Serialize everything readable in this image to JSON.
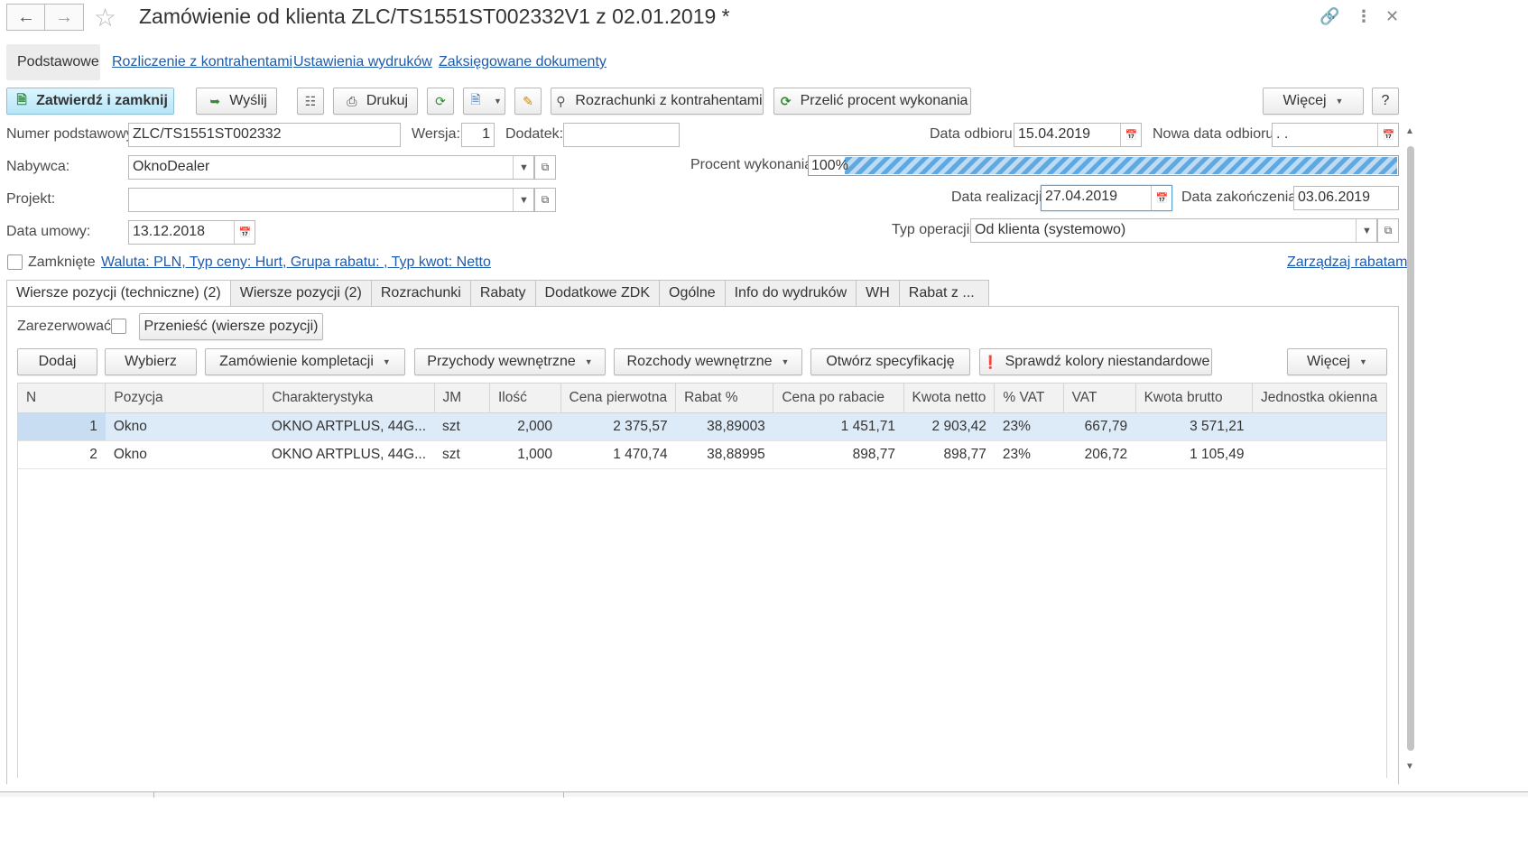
{
  "window": {
    "title": "Zamówienie od klienta ZLC/TS1551ST002332V1 z 02.01.2019 *"
  },
  "nav_tabs": [
    {
      "label": "Podstawowe"
    },
    {
      "label": "Rozliczenie z kontrahentami"
    },
    {
      "label": "Ustawienia wydruków"
    },
    {
      "label": "Zaksięgowane dokumenty"
    }
  ],
  "toolbar": {
    "confirm_close": "Zatwierdź i zamknij",
    "send": "Wyślij",
    "print": "Drukuj",
    "settlements": "Rozrachunki z kontrahentami",
    "recalc": "Przelić procent wykonania",
    "more": "Więcej",
    "help": "?"
  },
  "form": {
    "basic_number_label": "Numer podstawowy:",
    "basic_number": "ZLC/TS1551ST002332",
    "version_label": "Wersja:",
    "version": "1",
    "addendum_label": "Dodatek:",
    "addendum": "",
    "pickup_date_label": "Data odbioru:",
    "pickup_date": "15.04.2019",
    "new_pickup_date_label": "Nowa data odbioru:",
    "new_pickup_date": " .  .",
    "buyer_label": "Nabywca:",
    "buyer": "OknoDealer",
    "progress_label": "Procent wykonania:",
    "progress_text": "100%",
    "progress_value": 100,
    "project_label": "Projekt:",
    "project": "",
    "realization_date_label": "Data realizacji:",
    "realization_date": "27.04.2019",
    "end_date_label": "Data zakończenia:",
    "end_date": "03.06.2019",
    "contract_date_label": "Data umowy:",
    "contract_date": "13.12.2018",
    "operation_type_label": "Typ operacji:",
    "operation_type": "Od klienta (systemowo)",
    "closed_label": "Zamknięte",
    "currency_link": "Waluta: PLN, Typ ceny: Hurt, Grupa rabatu: , Typ kwot: Netto",
    "manage_discounts_link": "Zarządzaj rabatami"
  },
  "inner_tabs": [
    {
      "label": "Wiersze pozycji (techniczne) (2)"
    },
    {
      "label": "Wiersze pozycji (2)"
    },
    {
      "label": "Rozrachunki"
    },
    {
      "label": "Rabaty"
    },
    {
      "label": "Dodatkowe ZDK"
    },
    {
      "label": "Ogólne"
    },
    {
      "label": "Info do wydruków"
    },
    {
      "label": "WH"
    },
    {
      "label": "Rabat z ..."
    }
  ],
  "panel": {
    "reserve_label": "Zarezerwować:",
    "move_button": "Przenieść (wiersze pozycji)",
    "add": "Dodaj",
    "select": "Wybierz",
    "kit_order": "Zamówienie kompletacji",
    "internal_income": "Przychody wewnętrzne",
    "internal_expense": "Rozchody wewnętrzne",
    "open_spec": "Otwórz specyfikację",
    "check_colors": "Sprawdź kolory niestandardowe",
    "more": "Więcej"
  },
  "table": {
    "columns": [
      "N",
      "Pozycja",
      "Charakterystyka",
      "JM",
      "Ilość",
      "Cena pierwotna",
      "Rabat %",
      "Cena po rabacie",
      "Kwota netto",
      "% VAT",
      "VAT",
      "Kwota brutto",
      "Jednostka okienna"
    ],
    "rows": [
      [
        "1",
        "Okno",
        "OKNO ARTPLUS, 44G...",
        "szt",
        "2,000",
        "2 375,57",
        "38,89003",
        "1 451,71",
        "2 903,42",
        "23%",
        "667,79",
        "3 571,21",
        ""
      ],
      [
        "2",
        "Okno",
        "OKNO ARTPLUS, 44G...",
        "szt",
        "1,000",
        "1 470,74",
        "38,88995",
        "898,77",
        "898,77",
        "23%",
        "206,72",
        "1 105,49",
        ""
      ]
    ]
  }
}
